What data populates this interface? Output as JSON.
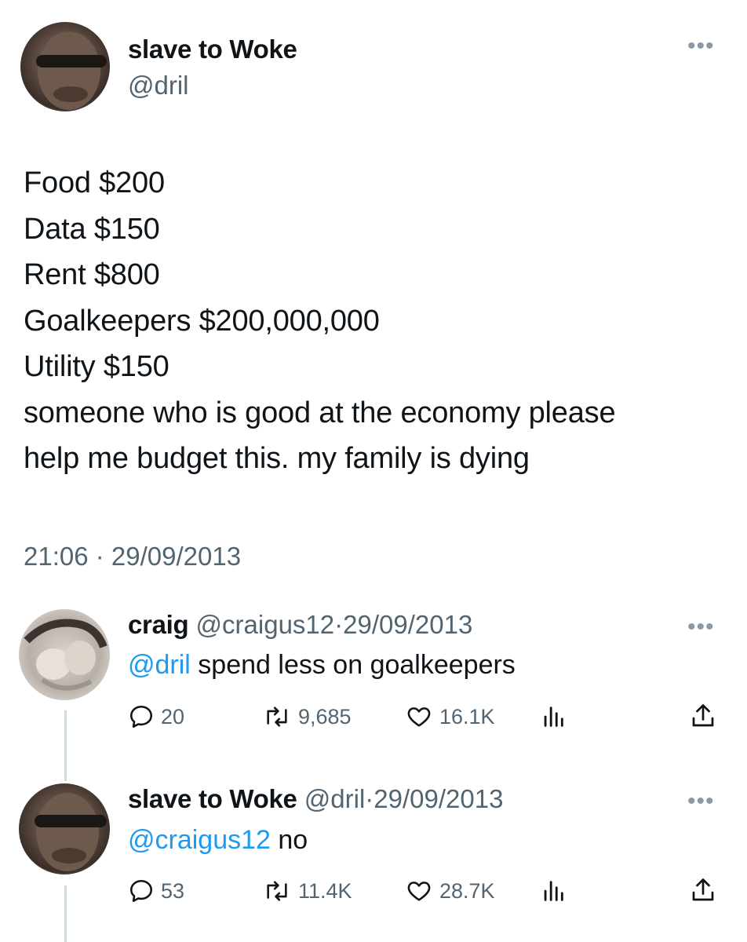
{
  "main_tweet": {
    "author_name": "slave to Woke",
    "author_handle": "@dril",
    "more_icon": "more-dots-icon",
    "lines": [
      "Food $200",
      "Data $150",
      "Rent $800",
      "Goalkeepers $200,000,000",
      "Utility $150",
      "someone who is good at the economy please",
      "help me budget this. my family is dying"
    ],
    "timestamp": "21:06 · 29/09/2013"
  },
  "replies": [
    {
      "author_name": "craig",
      "author_handle": "@craigus12",
      "separator": "·",
      "date": "29/09/2013",
      "mention": "@dril",
      "text": " spend less on goalkeepers",
      "reply_count": "20",
      "retweet_count": "9,685",
      "like_count": "16.1K"
    },
    {
      "author_name": "slave to Woke",
      "author_handle": "@dril",
      "separator": "·",
      "date": "29/09/2013",
      "mention": "@craigus12",
      "text": " no",
      "reply_count": "53",
      "retweet_count": "11.4K",
      "like_count": "28.7K"
    }
  ],
  "icons": {
    "reply": "reply-bubble-icon",
    "retweet": "retweet-icon",
    "like": "heart-icon",
    "views": "views-chart-icon",
    "share": "share-icon"
  },
  "colors": {
    "text": "#0f1419",
    "secondary": "#536471",
    "link": "#1d9bf0",
    "thread_line": "#cfd9de"
  }
}
